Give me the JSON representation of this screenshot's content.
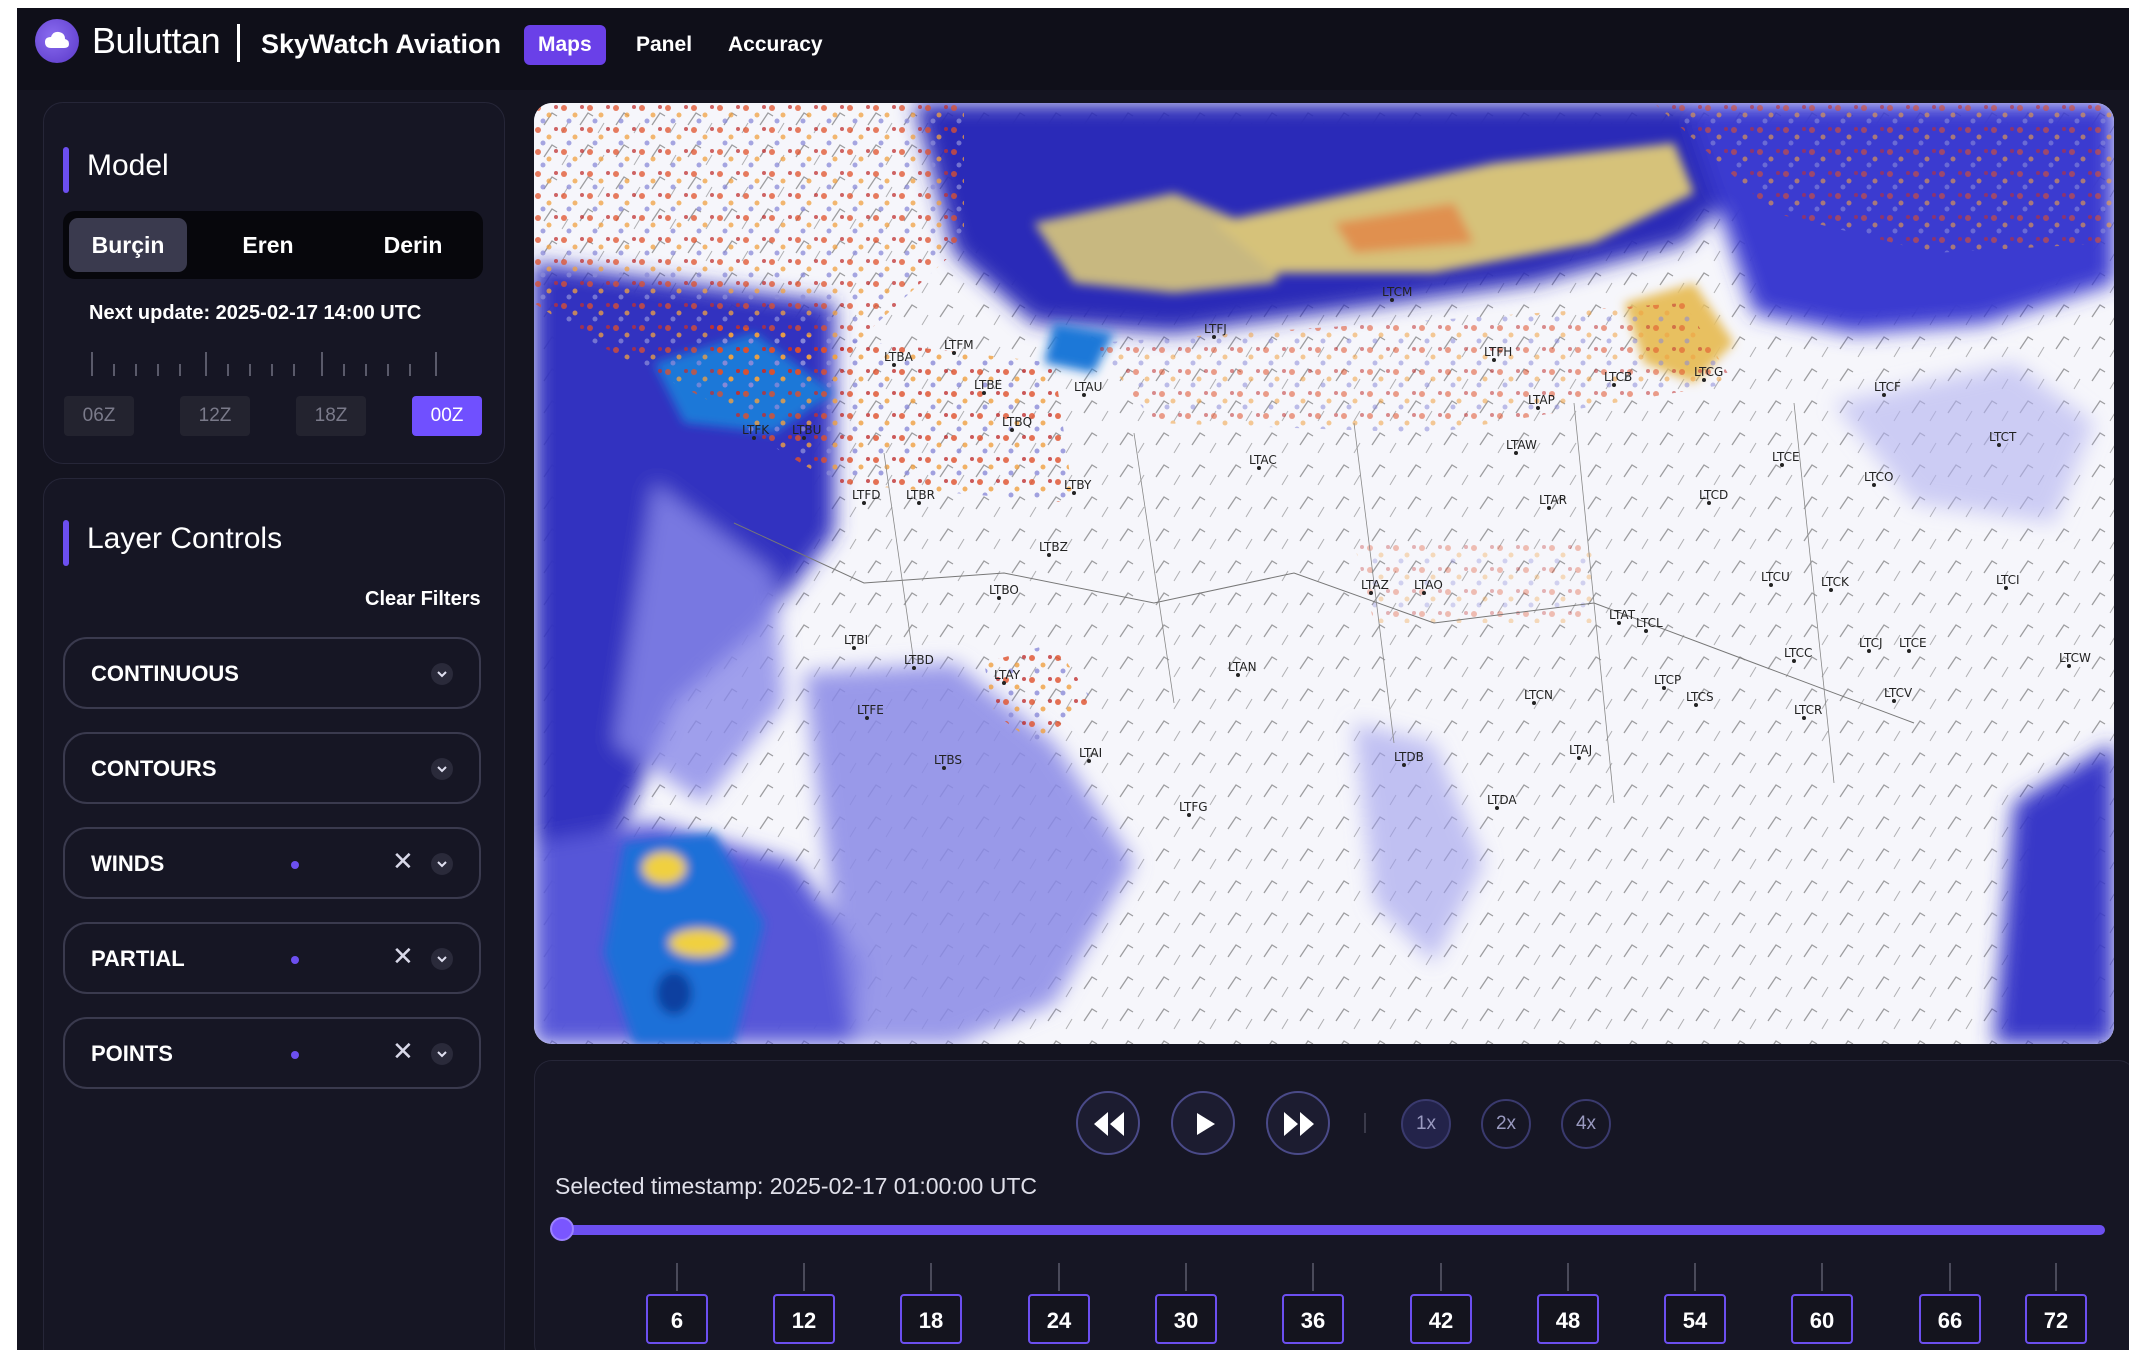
{
  "header": {
    "brand": "Buluttan",
    "app_name": "SkyWatch Aviation",
    "tabs": [
      {
        "label": "Maps",
        "active": true
      },
      {
        "label": "Panel",
        "active": false
      },
      {
        "label": "Accuracy",
        "active": false
      }
    ]
  },
  "model_panel": {
    "title": "Model",
    "models": [
      {
        "label": "Burçin",
        "active": true
      },
      {
        "label": "Eren",
        "active": false
      },
      {
        "label": "Derin",
        "active": false
      }
    ],
    "next_update": "Next update: 2025-02-17 14:00 UTC",
    "runs": [
      {
        "label": "06Z",
        "active": false
      },
      {
        "label": "12Z",
        "active": false
      },
      {
        "label": "18Z",
        "active": false
      },
      {
        "label": "00Z",
        "active": true
      }
    ]
  },
  "layer_panel": {
    "title": "Layer Controls",
    "clear_filters": "Clear Filters",
    "layers": [
      {
        "label": "CONTINUOUS",
        "active": false
      },
      {
        "label": "CONTOURS",
        "active": false
      },
      {
        "label": "WINDS",
        "active": true
      },
      {
        "label": "PARTIAL",
        "active": true
      },
      {
        "label": "POINTS",
        "active": true
      }
    ]
  },
  "map": {
    "airports": [
      "LTCM",
      "LTFM",
      "LTBA",
      "LTFJ",
      "LTFH",
      "LTCB",
      "LTCG",
      "LTCF",
      "LTCT",
      "LTCO",
      "LTCE",
      "LTAP",
      "LTAW",
      "LTAC",
      "LTAR",
      "LTCD",
      "LTBY",
      "LTBZ",
      "LTBO",
      "LTBI",
      "LTAZ",
      "LTAO",
      "LTAT",
      "LTCU",
      "LTCK",
      "LTCI",
      "LTCW",
      "LTCL",
      "LTCC",
      "LTCJ",
      "LTCE",
      "LTCP",
      "LTCS",
      "LTCN",
      "LTCR",
      "LTCV",
      "LTAN",
      "LTAY",
      "LTBD",
      "LTFE",
      "LTBS",
      "LTAI",
      "LTFG",
      "LTDB",
      "LTAJ",
      "LTDA",
      "LTFD",
      "LTBR",
      "LTBU",
      "LTBE",
      "LTFK",
      "LTBQ",
      "LTAU"
    ]
  },
  "timeline": {
    "speeds": [
      {
        "label": "1x",
        "active": true
      },
      {
        "label": "2x",
        "active": false
      },
      {
        "label": "4x",
        "active": false
      }
    ],
    "selected_timestamp": "Selected timestamp: 2025-02-17 01:00:00 UTC",
    "progress": 0,
    "hours": [
      "6",
      "12",
      "18",
      "24",
      "30",
      "36",
      "42",
      "48",
      "54",
      "60",
      "66",
      "72"
    ]
  }
}
